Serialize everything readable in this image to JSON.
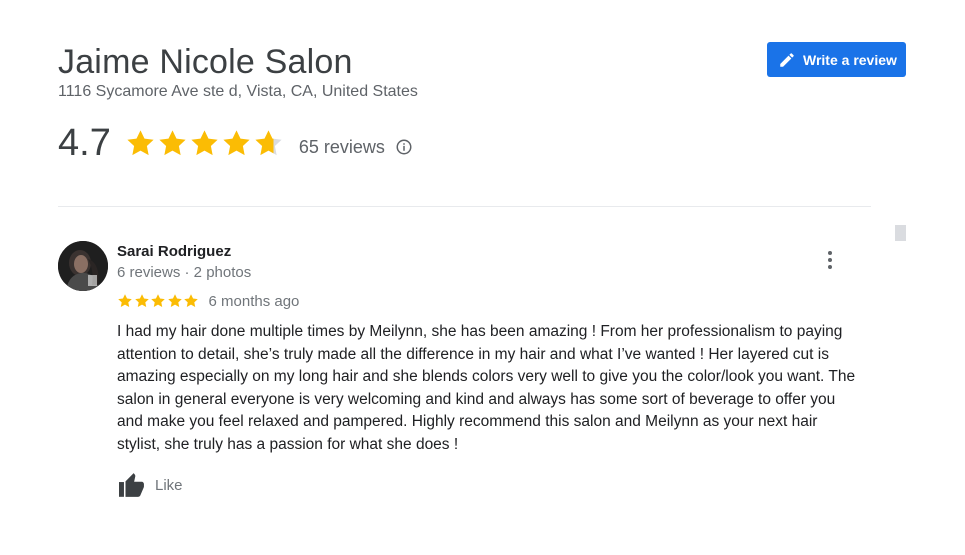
{
  "business": {
    "name": "Jaime Nicole Salon",
    "address": "1116 Sycamore Ave ste d, Vista, CA, United States",
    "rating": "4.7",
    "rating_value": 4.7,
    "review_count_label": "65 reviews"
  },
  "actions": {
    "write_review_label": "Write a review"
  },
  "review": {
    "reviewer_name": "Sarai Rodriguez",
    "reviewer_meta": "6 reviews · 2 photos",
    "stars": 5,
    "date": "6 months ago",
    "text": "I had my hair done multiple times by Meilynn, she has been amazing ! From her professionalism to paying attention to detail, she’s truly made all the difference in my hair and what I’ve wanted ! Her layered cut is amazing especially on my long hair and she blends colors very well to give you the color/look you want. The salon in general everyone is very welcoming and kind and always has some sort of beverage to offer you and make you feel relaxed and pampered. Highly recommend this salon and Meilynn as your next hair stylist, she truly has a passion for what she does !",
    "like_label": "Like"
  },
  "icons": {
    "write_review": "pencil-icon",
    "info": "info-icon",
    "more": "more-vert-icon",
    "like": "thumb-up-icon"
  },
  "colors": {
    "accent": "#1a73e8",
    "star": "#fbbc04",
    "star_empty": "#dadce0"
  }
}
